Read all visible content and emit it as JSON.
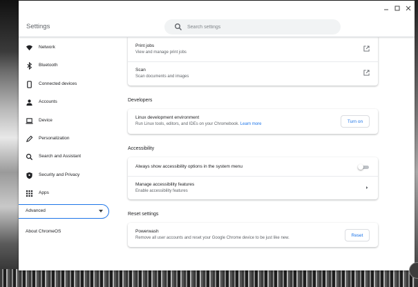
{
  "window": {
    "title": "Settings",
    "search_placeholder": "Search settings",
    "search_icon": "search-icon",
    "controls": [
      "minimize-icon",
      "maximize-icon",
      "close-icon"
    ]
  },
  "sidebar": {
    "items": [
      {
        "label": "Network",
        "icon": "wifi-icon"
      },
      {
        "label": "Bluetooth",
        "icon": "bluetooth-icon"
      },
      {
        "label": "Connected devices",
        "icon": "phone-icon"
      },
      {
        "label": "Accounts",
        "icon": "person-icon"
      },
      {
        "label": "Device",
        "icon": "laptop-icon"
      },
      {
        "label": "Personalization",
        "icon": "pen-icon"
      },
      {
        "label": "Search and Assistant",
        "icon": "search-icon"
      },
      {
        "label": "Security and Privacy",
        "icon": "shield-icon"
      },
      {
        "label": "Apps",
        "icon": "apps-grid-icon"
      }
    ],
    "advanced_label": "Advanced",
    "about_label": "About ChromeOS"
  },
  "main": {
    "printing": {
      "print_jobs_title": "Print jobs",
      "print_jobs_sub": "View and manage print jobs",
      "scan_title": "Scan",
      "scan_sub": "Scan documents and images"
    },
    "developers": {
      "heading": "Developers",
      "linux_title": "Linux development environment",
      "linux_sub": "Run Linux tools, editors, and IDEs on your Chromebook.",
      "learn_more": "Learn more",
      "turn_on_label": "Turn on"
    },
    "accessibility": {
      "heading": "Accessibility",
      "always_show_label": "Always show accessibility options in the system menu",
      "always_show_enabled": false,
      "manage_title": "Manage accessibility features",
      "manage_sub": "Enable accessibility features"
    },
    "reset": {
      "heading": "Reset settings",
      "powerwash_title": "Powerwash",
      "powerwash_sub": "Remove all user accounts and reset your Google Chrome device to be just like new.",
      "reset_label": "Reset"
    }
  },
  "colors": {
    "accent": "#1a73e8",
    "text_primary": "#202124",
    "text_secondary": "#5f6368"
  }
}
